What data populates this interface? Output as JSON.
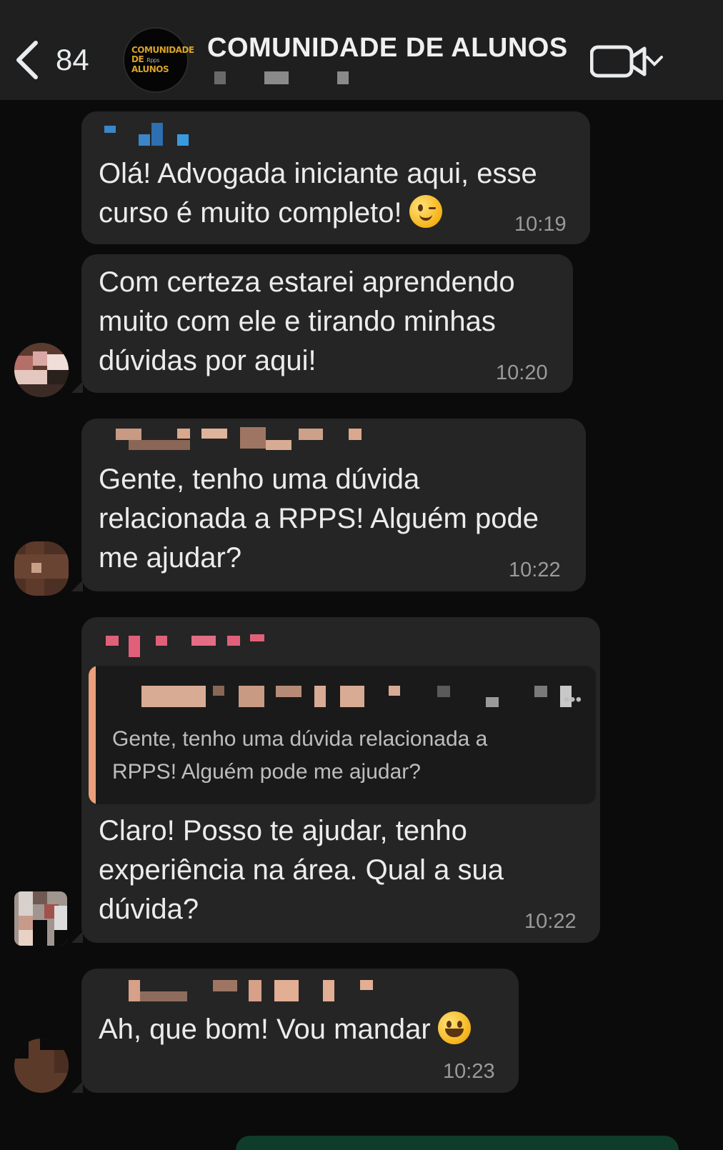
{
  "header": {
    "back_count": "84",
    "group_avatar_lines": [
      "COMUNIDADE",
      "DE",
      "ALUNOS"
    ],
    "group_avatar_sub": "Rpps",
    "title": "COMUNIDADE DE ALUNOS",
    "back_icon": "chevron-left-icon",
    "call_icon": "video-call-icon"
  },
  "messages": [
    {
      "text": "Olá! Advogada iniciante aqui, esse\ncurso é muito completo!",
      "emoji": "winking-face",
      "time": "10:19"
    },
    {
      "text": "Com certeza estarei aprendendo\nmuito com ele e tirando minhas\ndúvidas por aqui!",
      "time": "10:20"
    },
    {
      "text": "Gente, tenho uma dúvida\nrelacionada a RPPS! Alguém pode\nme ajudar?",
      "time": "10:22"
    },
    {
      "quoted_text": "Gente, tenho uma dúvida relacionada a\nRPPS! Alguém pode me ajudar?",
      "text": "Claro! Posso te ajudar, tenho\nexperiência na área. Qual a sua\ndúvida?",
      "time": "10:22"
    },
    {
      "text": "Ah, que bom! Vou mandar",
      "emoji": "grinning-face",
      "time": "10:23"
    }
  ],
  "colors": {
    "background": "#0b0b0b",
    "header": "#1f1f1f",
    "bubble": "#252525",
    "quote_accent": "#e9a07c",
    "avatar_gold": "#d8a328"
  }
}
